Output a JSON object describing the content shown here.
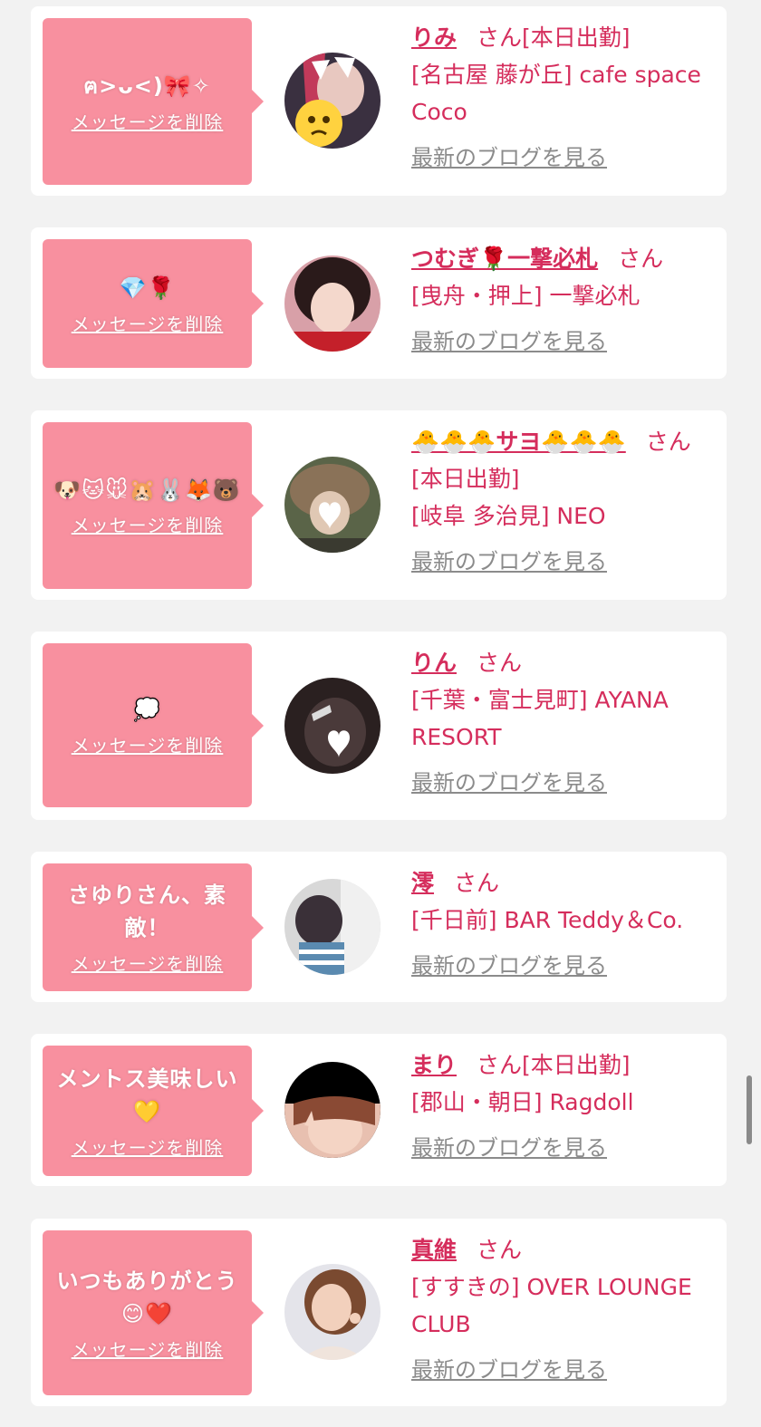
{
  "delete_label": "メッセージを削除",
  "blog_label": "最新のブログを見る",
  "san": "さん",
  "cards": [
    {
      "message": "ฅ>ᴗ<)🎀✧",
      "name": "りみ",
      "status": "[本日出勤]",
      "shop": "[名古屋 藤が丘] cafe space Coco",
      "avatar": "cat-girl-avatar"
    },
    {
      "message": "💎🌹",
      "name": "つむぎ🌹一撃必札",
      "status": "",
      "shop": "[曳舟・押上] 一撃必札",
      "avatar": "woman-avatar"
    },
    {
      "message": "🐶🐱🐭🐹🐰🦊🐻",
      "name": "🐣🐣🐣サヨ🐣🐣🐣",
      "status": "[本日出勤]",
      "shop": "[岐阜 多治見] NEO",
      "avatar": "hat-avatar"
    },
    {
      "message": "💭",
      "name": "りん",
      "status": "",
      "shop": "[千葉・富士見町] AYANA RESORT",
      "avatar": "dark-avatar"
    },
    {
      "message": "さゆりさん、素敵！",
      "name": "澪",
      "status": "",
      "shop": "[千日前] BAR Teddy＆Co.",
      "avatar": "mirror-avatar"
    },
    {
      "message": "メントス美味しい💛",
      "name": "まり",
      "status": "[本日出勤]",
      "shop": "[郡山・朝日] Ragdoll",
      "avatar": "peace-avatar"
    },
    {
      "message": "いつもありがとう😊❤️",
      "name": "真維",
      "status": "",
      "shop": "[すすきの] OVER LOUNGE CLUB",
      "avatar": "smile-avatar"
    }
  ]
}
